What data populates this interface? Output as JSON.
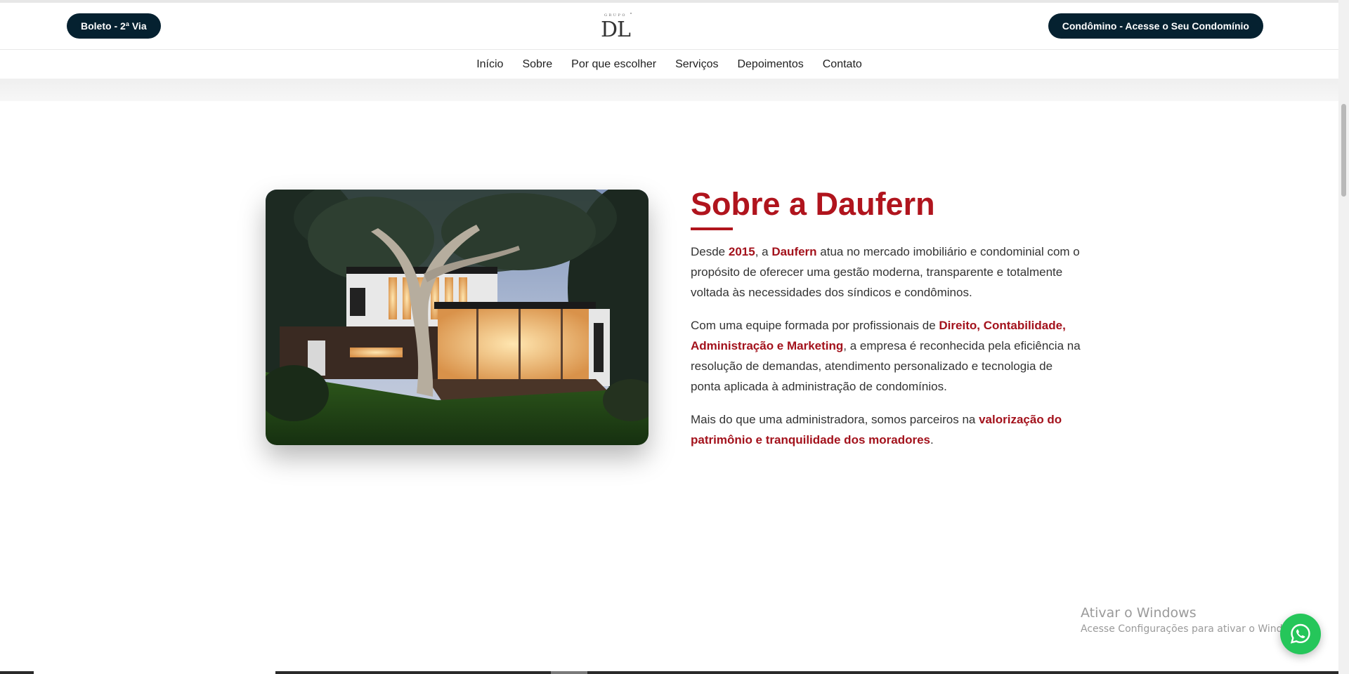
{
  "header": {
    "left_button": "Boleto - 2ª Via",
    "right_button": "Condômino - Acesse o Seu Condomínio",
    "logo_text": "DL",
    "logo_small_text": "GRUPO"
  },
  "nav": {
    "items": [
      "Início",
      "Sobre",
      "Por que escolher",
      "Serviços",
      "Depoimentos",
      "Contato"
    ]
  },
  "about": {
    "title": "Sobre a Daufern",
    "p1": {
      "t1": "Desde ",
      "b1": "2015",
      "t2": ", a ",
      "b2": "Daufern",
      "t3": " atua no mercado imobiliário e condominial com o propósito de oferecer uma gestão moderna, transparente e totalmente voltada às necessidades dos síndicos e condôminos."
    },
    "p2": {
      "t1": "Com uma equipe formada por profissionais de ",
      "b1": "Direito, Contabilidade, Administração e Marketing",
      "t2": ", a empresa é reconhecida pela eficiência na resolução de demandas, atendimento personalizado e tecnologia de ponta aplicada à administração de condomínios."
    },
    "p3": {
      "t1": "Mais do que uma administradora, somos parceiros na ",
      "b1": "valorização do patrimônio e tranquilidade dos moradores",
      "t2": "."
    }
  },
  "watermark": {
    "title": "Ativar o Windows",
    "subtitle": "Acesse Configurações para ativar o Windows."
  },
  "icons": {
    "whatsapp": "whatsapp-icon"
  },
  "colors": {
    "accent": "#b0141d",
    "dark": "#052130",
    "whatsapp": "#25c65a"
  }
}
